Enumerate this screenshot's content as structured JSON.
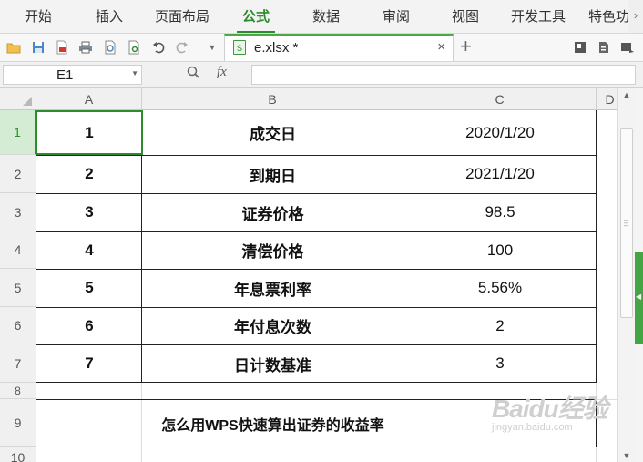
{
  "menu": {
    "items": [
      "开始",
      "插入",
      "页面布局",
      "公式",
      "数据",
      "审阅",
      "视图",
      "开发工具",
      "特色功"
    ],
    "active": "公式"
  },
  "tab": {
    "file_name": "e.xlsx *",
    "close_glyph": "×",
    "new_glyph": "+"
  },
  "formula_bar": {
    "cell_ref": "E1",
    "fx_label": "fx",
    "content": ""
  },
  "sheet": {
    "columns": [
      "A",
      "B",
      "C",
      "D"
    ],
    "rows": [
      "1",
      "2",
      "3",
      "4",
      "5",
      "6",
      "7",
      "8",
      "9",
      "10"
    ],
    "selected_cell": "A1",
    "table": [
      {
        "num": "1",
        "label": "成交日",
        "value": "2020/1/20"
      },
      {
        "num": "2",
        "label": "到期日",
        "value": "2021/1/20"
      },
      {
        "num": "3",
        "label": "证券价格",
        "value": "98.5"
      },
      {
        "num": "4",
        "label": "清偿价格",
        "value": "100"
      },
      {
        "num": "5",
        "label": "年息票利率",
        "value": "5.56%"
      },
      {
        "num": "6",
        "label": "年付息次数",
        "value": "2"
      },
      {
        "num": "7",
        "label": "日计数基准",
        "value": "3"
      }
    ],
    "footer_text": "怎么用WPS快速算出证券的收益率"
  },
  "watermark": {
    "main": "Baidu经验",
    "sub": "jingyan.baidu.com"
  },
  "colors": {
    "accent": "#2d8c2d",
    "border": "#222222"
  }
}
